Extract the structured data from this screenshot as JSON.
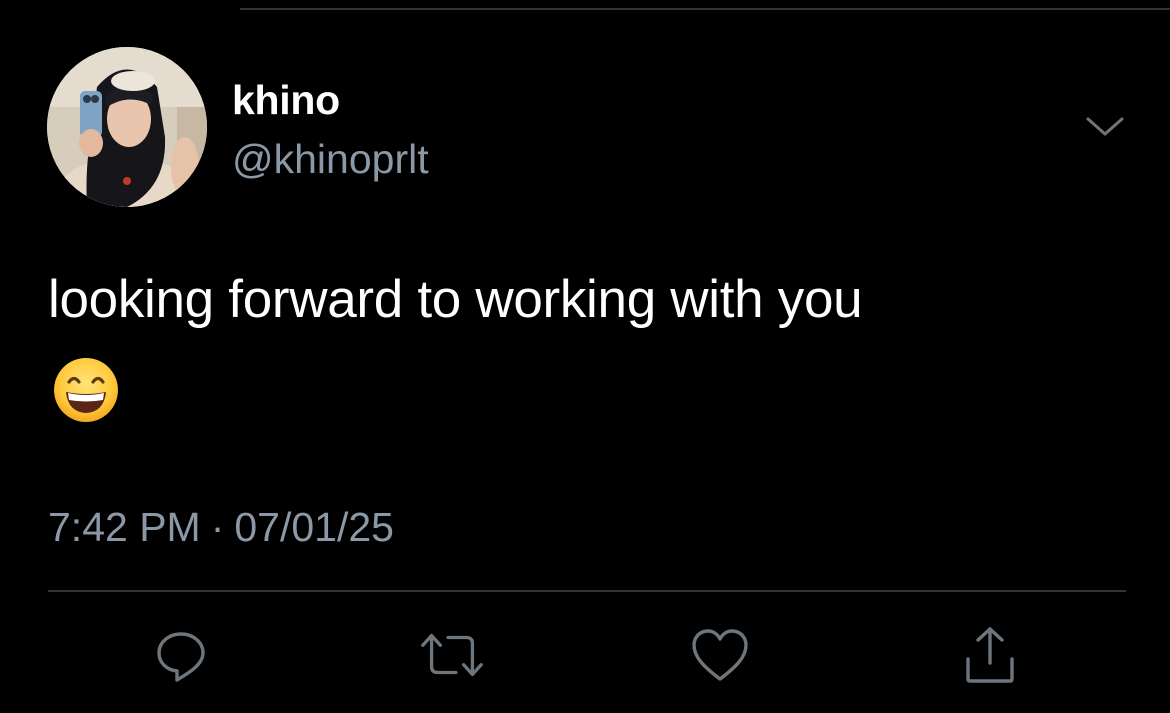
{
  "tweet": {
    "author": {
      "display_name": "khino",
      "handle": "@khinoprlt",
      "avatar": "profile-photo"
    },
    "text": "looking forward to working with you",
    "emoji": "😄",
    "time": "7:42 PM",
    "separator": "·",
    "date": "07/01/25"
  },
  "actions": {
    "reply": "reply-icon",
    "retweet": "retweet-icon",
    "like": "heart-icon",
    "share": "share-icon"
  },
  "menu": {
    "icon": "chevron-down-icon"
  },
  "colors": {
    "background": "#000000",
    "primary_text": "#ffffff",
    "secondary_text": "#8b98a5",
    "divider": "#2f3336"
  }
}
